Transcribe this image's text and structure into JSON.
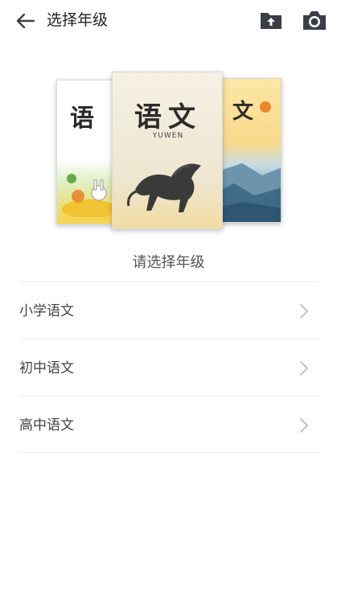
{
  "header": {
    "title": "选择年级",
    "back_icon": "arrow-left-icon",
    "folder_icon": "folder-upload-icon",
    "camera_icon": "camera-icon"
  },
  "books": {
    "center_title": "语文",
    "center_pinyin": "YUWEN",
    "left_title": "语",
    "right_title": "文"
  },
  "prompt": "请选择年级",
  "grades": [
    {
      "label": "小学语文"
    },
    {
      "label": "初中语文"
    },
    {
      "label": "高中语文"
    }
  ],
  "colors": {
    "icon": "#3a3f47",
    "divider": "#ececec",
    "chevron": "#b5b5b5"
  }
}
